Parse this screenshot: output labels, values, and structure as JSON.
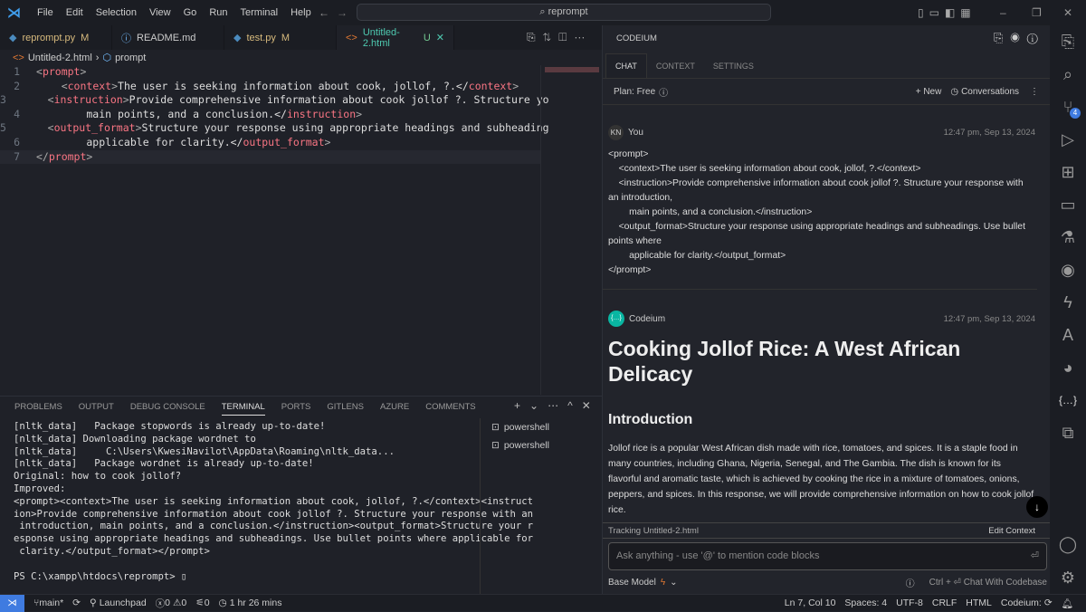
{
  "menu": [
    "File",
    "Edit",
    "Selection",
    "View",
    "Go",
    "Run",
    "Terminal",
    "Help"
  ],
  "search": "reprompt",
  "tabs": [
    {
      "name": "reprompt.py",
      "badge": "M"
    },
    {
      "name": "README.md",
      "badge": ""
    },
    {
      "name": "test.py",
      "badge": "M"
    },
    {
      "name": "Untitled-2.html",
      "badge": "U"
    }
  ],
  "breadcrumb": {
    "file": "Untitled-2.html",
    "symbol": "prompt"
  },
  "code": [
    [
      [
        "1"
      ],
      [
        "p",
        "<"
      ],
      [
        "t",
        "prompt"
      ],
      [
        "p",
        ">"
      ]
    ],
    [
      [
        "2"
      ],
      [
        "p",
        "    <"
      ],
      [
        "t",
        "context"
      ],
      [
        "p",
        ">"
      ],
      [
        "tx",
        "The user is seeking information about cook, jollof, ?.</"
      ],
      [
        "t",
        "context"
      ],
      [
        "p",
        ">"
      ]
    ],
    [
      [
        "3"
      ],
      [
        "p",
        "    <"
      ],
      [
        "t",
        "instruction"
      ],
      [
        "p",
        ">"
      ],
      [
        "tx",
        "Provide comprehensive information about cook jollof ?. Structure yo"
      ]
    ],
    [
      [
        "4"
      ],
      [
        "tx",
        "        main points, and a conclusion.</"
      ],
      [
        "t",
        "instruction"
      ],
      [
        "p",
        ">"
      ]
    ],
    [
      [
        "5"
      ],
      [
        "p",
        "    <"
      ],
      [
        "t",
        "output_format"
      ],
      [
        "p",
        ">"
      ],
      [
        "tx",
        "Structure your response using appropriate headings and subheading"
      ]
    ],
    [
      [
        "6"
      ],
      [
        "tx",
        "        applicable for clarity.</"
      ],
      [
        "t",
        "output_format"
      ],
      [
        "p",
        ">"
      ]
    ],
    [
      [
        "7"
      ],
      [
        "p",
        "</"
      ],
      [
        "t",
        "prompt"
      ],
      [
        "p",
        ">"
      ]
    ]
  ],
  "panel_tabs": [
    "PROBLEMS",
    "OUTPUT",
    "DEBUG CONSOLE",
    "TERMINAL",
    "PORTS",
    "GITLENS",
    "AZURE",
    "COMMENTS"
  ],
  "terminal": "[nltk_data]   Package stopwords is already up-to-date!\n[nltk_data] Downloading package wordnet to\n[nltk_data]     C:\\Users\\KwesiNavilot\\AppData\\Roaming\\nltk_data...\n[nltk_data]   Package wordnet is already up-to-date!\nOriginal: how to cook jollof?\nImproved:\n<prompt><context>The user is seeking information about cook, jollof, ?.</context><instruct\nion>Provide comprehensive information about cook jollof ?. Structure your response with an\n introduction, main points, and a conclusion.</instruction><output_format>Structure your r\nesponse using appropriate headings and subheadings. Use bullet points where applicable for\n clarity.</output_format></prompt>\n\nPS C:\\xampp\\htdocs\\reprompt> ▯",
  "shells": [
    "powershell",
    "powershell"
  ],
  "status": {
    "branch": "main*",
    "launchpad": "Launchpad",
    "errors": "0",
    "warnings": "0",
    "ports": "0",
    "time": "1 hr 26 mins",
    "ln": "Ln 7, Col 10",
    "spaces": "Spaces: 4",
    "enc": "UTF-8",
    "eol": "CRLF",
    "lang": "HTML",
    "codeium": "Codeium:"
  },
  "chat": {
    "title": "CODEIUM",
    "tabs": [
      "CHAT",
      "CONTEXT",
      "SETTINGS"
    ],
    "plan": "Plan: Free",
    "new": "+ New",
    "conversations": "Conversations",
    "user": {
      "initials": "KN",
      "name": "You",
      "time": "12:47 pm, Sep 13, 2024",
      "text": "<prompt>\n    <context>The user is seeking information about cook, jollof, ?.</context>\n    <instruction>Provide comprehensive information about cook jollof ?. Structure your response with an introduction,\n        main points, and a conclusion.</instruction>\n    <output_format>Structure your response using appropriate headings and subheadings. Use bullet points where\n        applicable for clarity.</output_format>\n</prompt>"
    },
    "bot": {
      "name": "Codeium",
      "time": "12:47 pm, Sep 13, 2024",
      "h1": "Cooking Jollof Rice: A West African Delicacy",
      "h2": "Introduction",
      "p": "Jollof rice is a popular West African dish made with rice, tomatoes, and spices. It is a staple food in many countries, including Ghana, Nigeria, Senegal, and The Gambia. The dish is known for its flavorful and aromatic taste, which is achieved by cooking the rice in a mixture of tomatoes, onions, peppers, and spices. In this response, we will provide comprehensive information on how to cook jollof rice."
    },
    "tracking": "Tracking Untitled-2.html",
    "edit_context": "Edit Context",
    "placeholder": "Ask anything - use '@' to mention code blocks",
    "model": "Base Model",
    "hint": "Ctrl + ⏎ Chat With Codebase"
  },
  "scm_badge": "4",
  "colors": {
    "accent": "#3f7be0",
    "tag": "#f97583",
    "codeium": "#09b6a2"
  }
}
